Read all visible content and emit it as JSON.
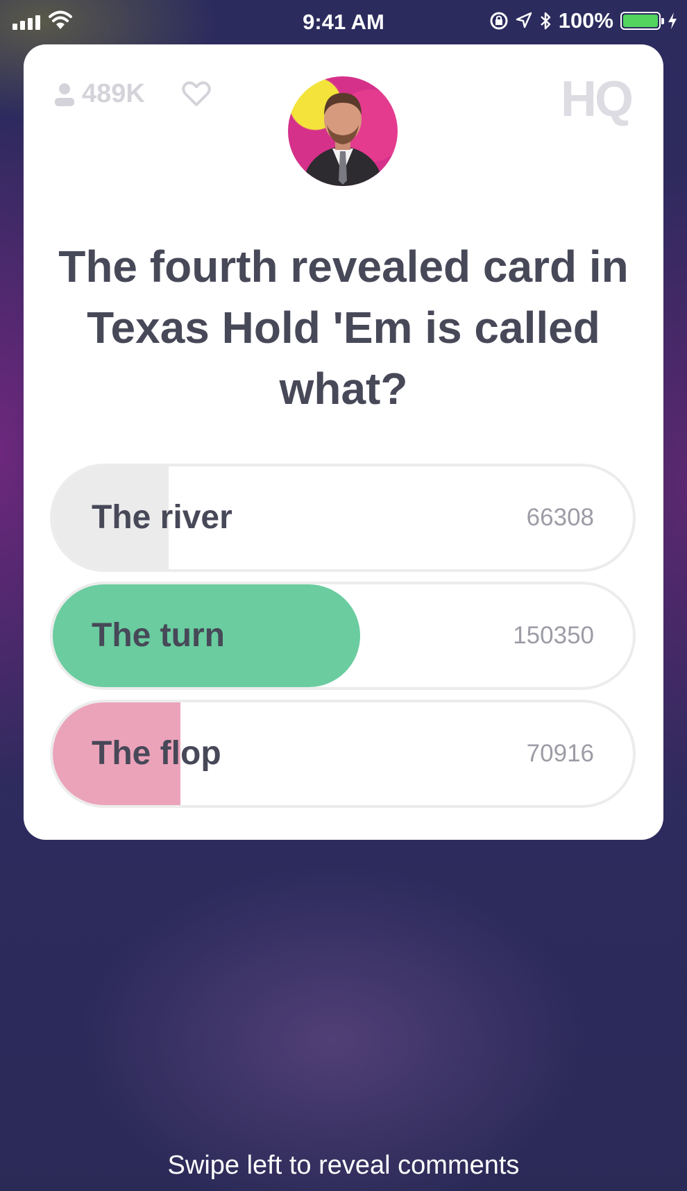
{
  "status_bar": {
    "time": "9:41 AM",
    "battery": "100%",
    "battery_level": 1.0,
    "icons": [
      "signal-icon",
      "wifi-icon",
      "rotation-lock-icon",
      "location-icon",
      "bluetooth-icon",
      "battery-icon",
      "charging-icon"
    ]
  },
  "header": {
    "player_count": "489K",
    "logo": "HQ",
    "icons": [
      "person-icon",
      "heart-icon"
    ]
  },
  "question": "The fourth revealed card in Texas Hold 'Em is called what?",
  "answers": [
    {
      "label": "The river",
      "count": "66308",
      "fill_fraction": 0.2,
      "fill_color": "#ebebeb"
    },
    {
      "label": "The turn",
      "count": "150350",
      "fill_fraction": 0.53,
      "fill_color": "#6acc9f",
      "correct": true
    },
    {
      "label": "The flop",
      "count": "70916",
      "fill_fraction": 0.22,
      "fill_color": "#eba3ba"
    }
  ],
  "footer_hint": "Swipe left to reveal comments",
  "colors": {
    "correct": "#6acc9f",
    "selected_wrong": "#eba3ba",
    "neutral": "#ebebeb",
    "text_dark": "#474858"
  }
}
